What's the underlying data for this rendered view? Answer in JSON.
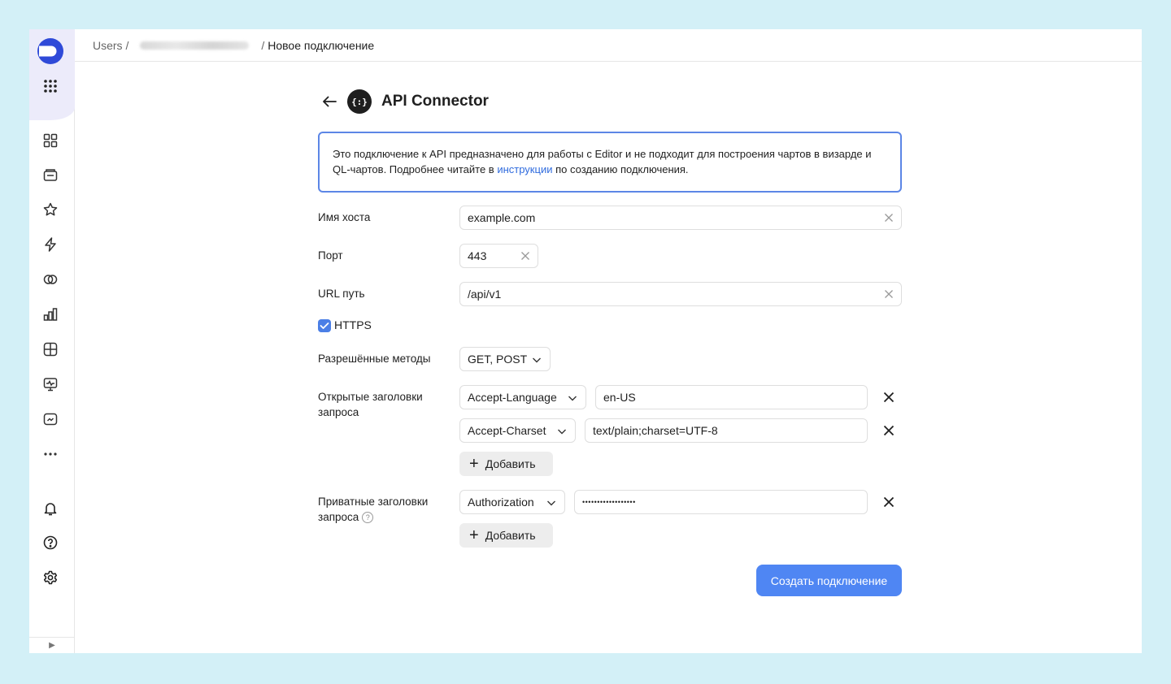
{
  "breadcrumb": {
    "root": "Users /",
    "separator": "/",
    "current": "Новое подключение"
  },
  "header": {
    "title": "API Connector",
    "connector_icon_text": "{:}"
  },
  "info": {
    "text_before": "Это подключение к API предназначено для работы с Editor и не подходит для построения чартов в визарде и QL-чартов. Подробнее читайте в ",
    "link": "инструкции",
    "text_after": " по созданию подключения."
  },
  "form": {
    "host": {
      "label": "Имя хоста",
      "value": "example.com"
    },
    "port": {
      "label": "Порт",
      "value": "443"
    },
    "path": {
      "label": "URL путь",
      "value": "/api/v1"
    },
    "https": {
      "label": "HTTPS",
      "checked": true
    },
    "methods": {
      "label": "Разрешённые методы",
      "value": "GET, POST"
    },
    "public_headers": {
      "label": "Открытые заголовки запроса",
      "rows": [
        {
          "name": "Accept-Language",
          "value": "en-US"
        },
        {
          "name": "Accept-Charset",
          "value": "text/plain;charset=UTF-8"
        }
      ],
      "add_label": "Добавить"
    },
    "private_headers": {
      "label": "Приватные заголовки запроса",
      "help": "?",
      "rows": [
        {
          "name": "Authorization",
          "value": "••••••••••••••••••"
        }
      ],
      "add_label": "Добавить"
    },
    "submit_label": "Создать подключение"
  },
  "sidebar": {
    "expand": "▶"
  },
  "colors": {
    "accent": "#4f86f3",
    "info_border": "#5c86e6",
    "link": "#2f6bde",
    "background": "#d3f0f7",
    "sidebar_top": "#ecebfa"
  }
}
